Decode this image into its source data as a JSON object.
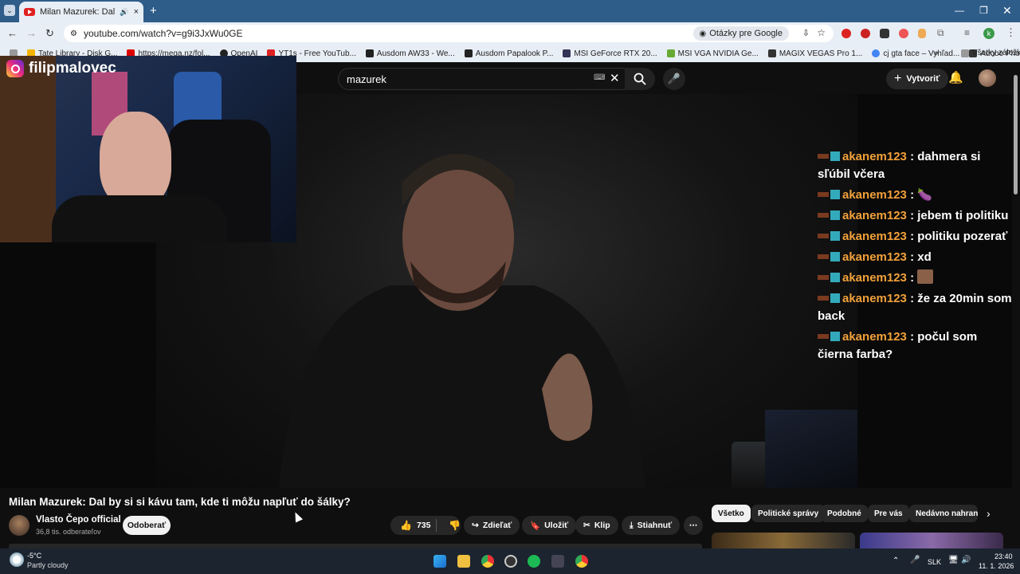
{
  "browser": {
    "tab_title": "Milan Mazurek: Dal by si s",
    "url": "youtube.com/watch?v=g9i3JxWu0GE",
    "google_btn": "Otázky pre Google",
    "new_tab": "+",
    "all_bookmarks": "Všetky záložky",
    "bookmarks": [
      "Tate Library - Disk G...",
      "https://mega.nz/fol...",
      "OpenAI",
      "YT1s - Free YouTub...",
      "Ausdom AW33 - We...",
      "Ausdom Papalook P...",
      "MSI GeForce RTX 20...",
      "MSI VGA NVIDIA Ge...",
      "MAGIX VEGAS Pro 1...",
      "cj gta face – Vyhľad...",
      "Adobe Photoshop 2..."
    ]
  },
  "yt": {
    "search_value": "mazurek",
    "create_label": "Vytvoriť",
    "video_title": "Milan Mazurek: Dal by si si kávu tam, kde ti môžu napľuť do šálky?",
    "channel_name": "Vlasto Čepo official",
    "channel_subs": "36,8 tis. odberateľov",
    "subscribe": "Odoberať",
    "likes": "735",
    "share": "Zdieľať",
    "save": "Uložiť",
    "clip": "Klip",
    "download": "Stiahnuť",
    "chips": [
      "Všetko",
      "Politické správy",
      "Podobné",
      "Pre vás",
      "Nedávno nahrané"
    ]
  },
  "overlay": {
    "instagram_handle": "filipmalovec",
    "chat": [
      {
        "user": "akanem123",
        "text": "dahmera si sľúbil včera"
      },
      {
        "user": "akanem123",
        "text": "🍆"
      },
      {
        "user": "akanem123",
        "text": "jebem ti politiku"
      },
      {
        "user": "akanem123",
        "text": "politiku pozerať"
      },
      {
        "user": "akanem123",
        "text": "xd"
      },
      {
        "user": "akanem123",
        "text": ""
      },
      {
        "user": "akanem123",
        "text": "že za 20min som back"
      },
      {
        "user": "akanem123",
        "text": "počul som čierna farba?"
      }
    ]
  },
  "taskbar": {
    "weather_temp": "-5°C",
    "weather_desc": "Partly cloudy",
    "lang": "SLK",
    "time": "23:40",
    "date": "11. 1. 2026"
  },
  "colors": {
    "chat_username": "#f2a13a",
    "yt_red": "#e02020",
    "browser_frame": "#2f5d8a"
  }
}
